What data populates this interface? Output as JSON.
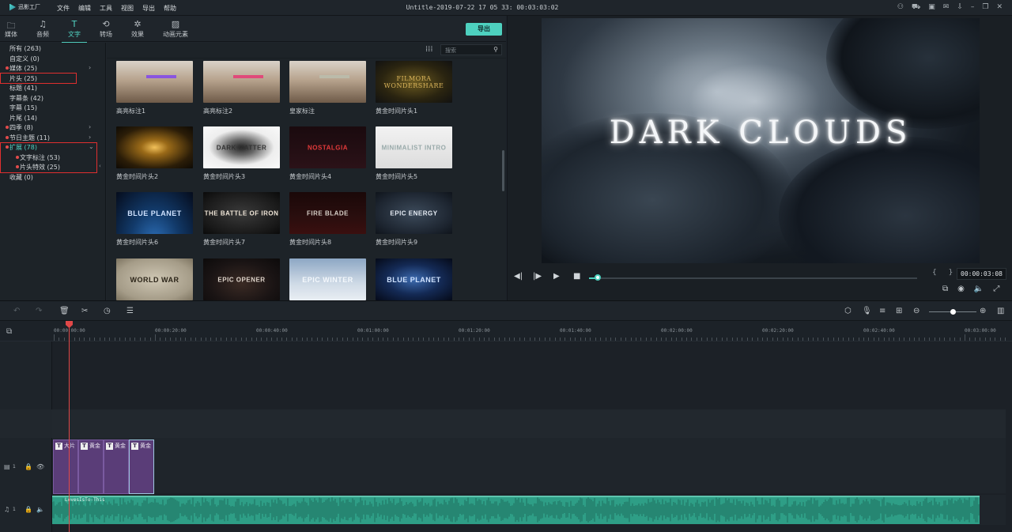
{
  "app": {
    "logo_text": "迅影工厂",
    "menu": [
      "文件",
      "编辑",
      "工具",
      "视图",
      "导出",
      "帮助"
    ],
    "doc_title": "Untitle-2019-07-22 17 05 33: 00:03:03:02",
    "window_icons": [
      "user-icon",
      "cart-icon",
      "save-icon",
      "mail-icon",
      "download-icon",
      "minimize-icon",
      "restore-icon",
      "close-icon"
    ]
  },
  "library": {
    "tabs": [
      {
        "label": "媒体",
        "icon": "folder-icon"
      },
      {
        "label": "音频",
        "icon": "music-icon"
      },
      {
        "label": "文字",
        "icon": "text-icon",
        "active": true
      },
      {
        "label": "转场",
        "icon": "transition-icon"
      },
      {
        "label": "效果",
        "icon": "effects-icon"
      },
      {
        "label": "动画元素",
        "icon": "image-icon"
      }
    ],
    "export_label": "导出",
    "search_placeholder": "搜索",
    "categories": [
      {
        "label": "所有 (263)"
      },
      {
        "label": "自定义 (0)"
      },
      {
        "label": "媒体 (25)",
        "dot": true,
        "chevron": ">"
      },
      {
        "label": "片头 (25)",
        "highlighted": true
      },
      {
        "label": "标题 (41)"
      },
      {
        "label": "字幕条 (42)"
      },
      {
        "label": "字幕 (15)"
      },
      {
        "label": "片尾 (14)"
      },
      {
        "label": "四季 (8)",
        "dot": true,
        "chevron": ">"
      },
      {
        "label": "节日主题 (11)",
        "dot": true,
        "chevron": ">"
      },
      {
        "label": "扩展 (78)",
        "dot": true,
        "chevron": "v",
        "expanded": true
      },
      {
        "label": "文字标注 (53)",
        "dot": true,
        "sub": true
      },
      {
        "label": "片头特效 (25)",
        "dot": true,
        "sub": true
      },
      {
        "label": "收藏 (0)"
      }
    ],
    "thumbnails": [
      {
        "label": "高亮标注1",
        "text": "",
        "style": "portrait"
      },
      {
        "label": "高亮标注2",
        "text": "",
        "style": "portrait"
      },
      {
        "label": "皇家标注",
        "text": "",
        "style": "portrait"
      },
      {
        "label": "黄金时间片头1",
        "text": "FILMORA WONDERSHARE",
        "style": "gold"
      },
      {
        "label": "黄金时间片头2",
        "text": "",
        "style": "goldflare"
      },
      {
        "label": "黄金时间片头3",
        "text": "DARK MATTER",
        "style": "white"
      },
      {
        "label": "黄金时间片头4",
        "text": "NOSTALGIA",
        "style": "red"
      },
      {
        "label": "黄金时间片头5",
        "text": "MINIMALIST INTRO",
        "style": "light"
      },
      {
        "label": "黄金时间片头6",
        "text": "BLUE PLANET",
        "style": "earth"
      },
      {
        "label": "黄金时间片头7",
        "text": "THE BATTLE OF IRON",
        "style": "battle"
      },
      {
        "label": "黄金时间片头8",
        "text": "FIRE BLADE",
        "style": "fire"
      },
      {
        "label": "黄金时间片头9",
        "text": "EPIC ENERGY",
        "style": "energy"
      },
      {
        "label": "",
        "text": "WORLD WAR",
        "style": "paper"
      },
      {
        "label": "",
        "text": "EPIC OPENER",
        "style": "dark"
      },
      {
        "label": "",
        "text": "EPIC WINTER",
        "style": "winter"
      },
      {
        "label": "",
        "text": "BLUE PLANET",
        "style": "earth2"
      }
    ]
  },
  "preview": {
    "title_text": "DARK CLOUDS",
    "timecode": "00:00:03:08",
    "braces": "{ }",
    "progress": 0.02
  },
  "timeline": {
    "ruler_labels": [
      "00:00:00:00",
      "00:00:20:00",
      "00:00:40:00",
      "00:01:00:00",
      "00:01:20:00",
      "00:01:40:00",
      "00:02:00:00",
      "00:02:20:00",
      "00:02:40:00",
      "00:03:00:00"
    ],
    "video_track_label": "1",
    "audio_track_label": "1",
    "clips": [
      {
        "label": "大片"
      },
      {
        "label": "黄金"
      },
      {
        "label": "黄金"
      },
      {
        "label": "黄金"
      }
    ],
    "audio_clip_label": "LovesIsTo-This"
  }
}
